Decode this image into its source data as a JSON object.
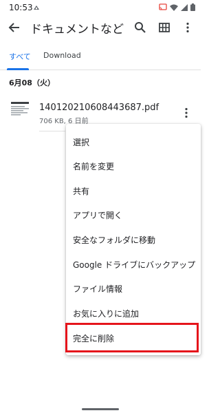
{
  "status_bar": {
    "time": "10:53",
    "left_icon": "cloud-sync-icon",
    "right_icons": [
      "cast-icon",
      "wifi-icon",
      "signal-icon",
      "battery-icon"
    ]
  },
  "app_bar": {
    "title": "ドキュメントなど",
    "icons": [
      "back-arrow-icon",
      "search-icon",
      "grid-view-icon",
      "more-vert-icon"
    ]
  },
  "tabs": [
    {
      "label": "すべて",
      "active": true
    },
    {
      "label": "Download",
      "active": false
    }
  ],
  "date_header": "6月08（火）",
  "file": {
    "name": "140120210608443687.pdf",
    "meta": "706 KB, 6 日前"
  },
  "context_menu": {
    "items": [
      "選択",
      "名前を変更",
      "共有",
      "アプリで開く",
      "安全なフォルダに移動",
      "Google ドライブにバックアップ",
      "ファイル情報",
      "お気に入りに追加",
      "完全に削除"
    ],
    "highlighted_item": "完全に削除",
    "highlight_color": "#e5141b"
  },
  "colors": {
    "accent": "#1a73e8",
    "text_primary": "#202124",
    "text_secondary": "#5f6368"
  }
}
